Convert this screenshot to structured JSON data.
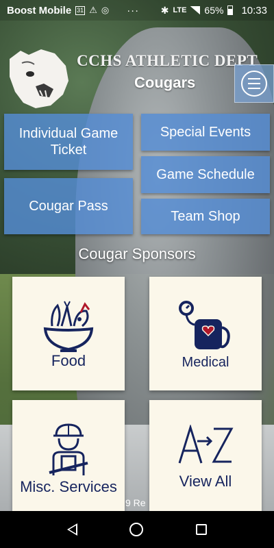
{
  "status_bar": {
    "carrier": "Boost Mobile",
    "calendar_day": "31",
    "dots": "···",
    "network": "LTE",
    "battery": "65%",
    "time": "10:33"
  },
  "header": {
    "title": "CCHS ATHLETIC DEPT",
    "subtitle": "Cougars"
  },
  "nav_buttons": {
    "individual_game_ticket": "Individual Game Ticket",
    "special_events": "Special Events",
    "game_schedule": "Game Schedule",
    "cougar_pass": "Cougar Pass",
    "team_shop": "Team Shop"
  },
  "sponsors": {
    "title": "Cougar Sponsors",
    "cards": [
      {
        "label": "Food",
        "icon": "food-bowl-icon"
      },
      {
        "label": "Medical",
        "icon": "blood-pressure-icon"
      },
      {
        "label": "Misc. Services",
        "icon": "worker-icon"
      },
      {
        "label": "View All",
        "icon": "a-to-z-icon"
      }
    ]
  },
  "footer": {
    "text": "9  Re"
  },
  "colors": {
    "button_bg": "#548cd4",
    "card_bg": "#fbf7ea",
    "icon_navy": "#16245e",
    "icon_red": "#b0182a"
  }
}
